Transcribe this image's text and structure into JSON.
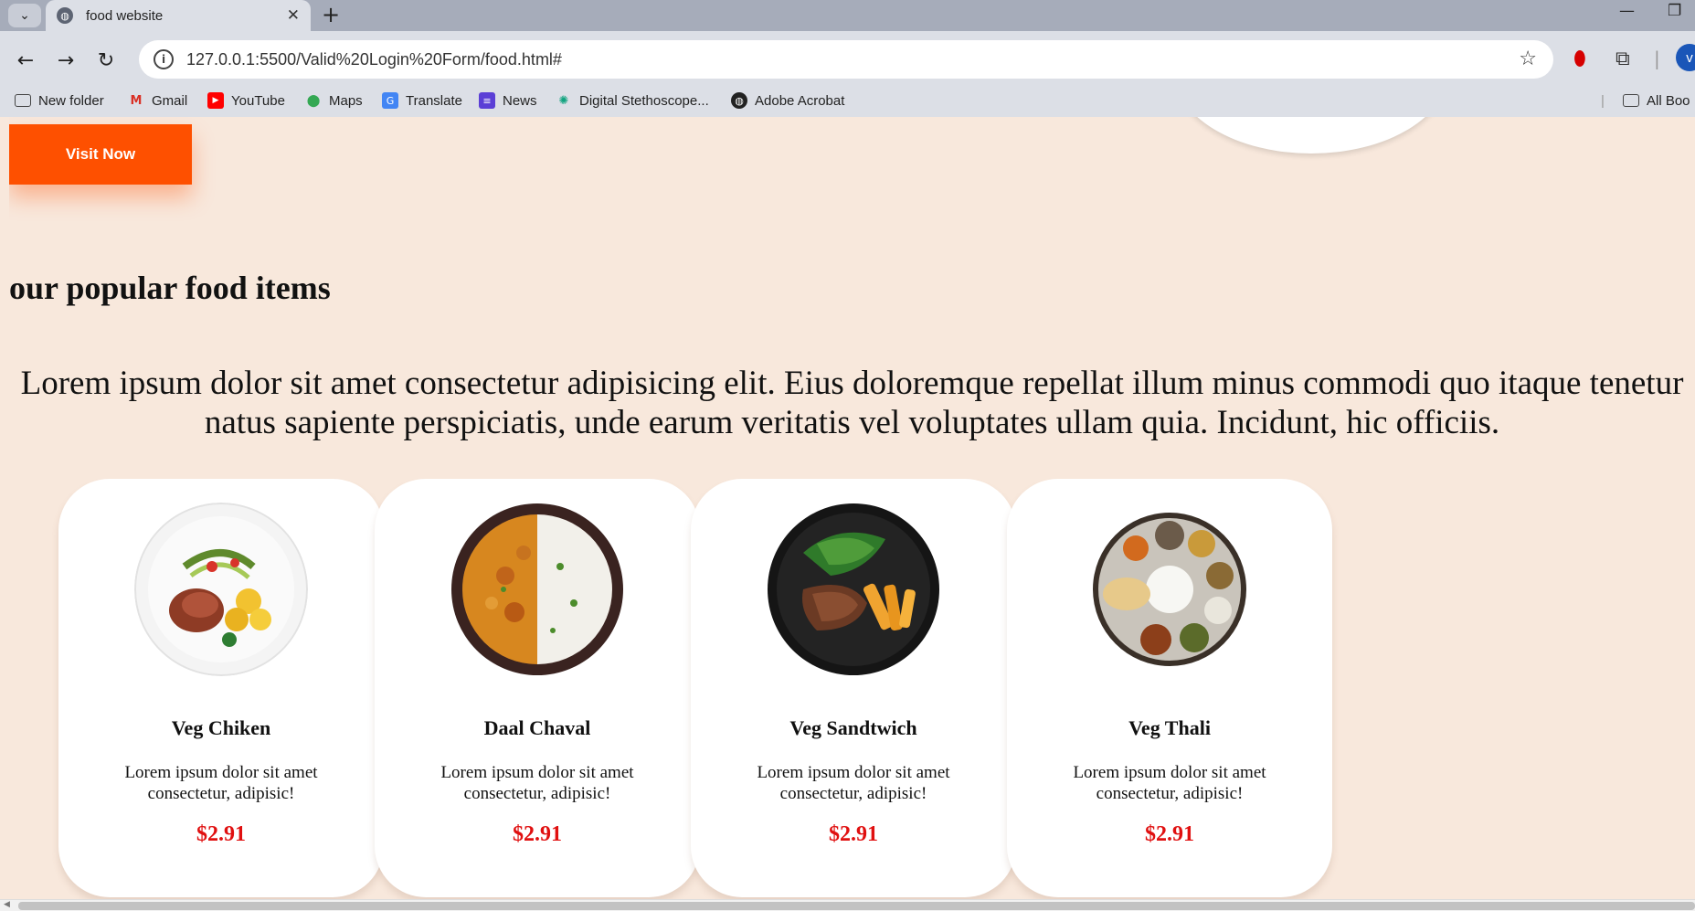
{
  "browser": {
    "tab_title": "food website",
    "url": "127.0.0.1:5500/Valid%20Login%20Form/food.html#",
    "profile_initial": "v",
    "bookmarks": [
      {
        "label": "New folder",
        "icon": "folder-icon"
      },
      {
        "label": "Gmail",
        "icon": "gmail-icon"
      },
      {
        "label": "YouTube",
        "icon": "youtube-icon"
      },
      {
        "label": "Maps",
        "icon": "maps-icon"
      },
      {
        "label": "Translate",
        "icon": "translate-icon"
      },
      {
        "label": "News",
        "icon": "news-icon"
      },
      {
        "label": "Digital Stethoscope...",
        "icon": "chatgpt-icon"
      },
      {
        "label": "Adobe Acrobat",
        "icon": "globe-icon"
      }
    ],
    "all_bookmarks": "All Boo"
  },
  "page": {
    "visit_button": "Visit Now",
    "section_title": "our popular food items",
    "lead_line1": "Lorem ipsum dolor sit amet consectetur adipisicing elit. Eius doloremque repellat illum minus commodi quo itaque tenetur",
    "lead_line2": "natus sapiente perspiciatis, unde earum veritatis vel voluptates ullam quia. Incidunt, hic officiis.",
    "cards": [
      {
        "name": "Veg Chiken",
        "desc": "Lorem ipsum dolor sit amet consectetur, adipisic!",
        "price": "$2.91",
        "image": "grilled-meat-plate"
      },
      {
        "name": "Daal Chaval",
        "desc": "Lorem ipsum dolor sit amet consectetur, adipisic!",
        "price": "$2.91",
        "image": "curry-rice-bowl"
      },
      {
        "name": "Veg Sandtwich",
        "desc": "Lorem ipsum dolor sit amet consectetur, adipisic!",
        "price": "$2.91",
        "image": "steak-fries-plate"
      },
      {
        "name": "Veg Thali",
        "desc": "Lorem ipsum dolor sit amet consectetur, adipisic!",
        "price": "$2.91",
        "image": "thali-platter"
      }
    ]
  },
  "colors": {
    "page_bg": "#f8e8dc",
    "accent": "#fe5000",
    "price": "#e01010"
  }
}
